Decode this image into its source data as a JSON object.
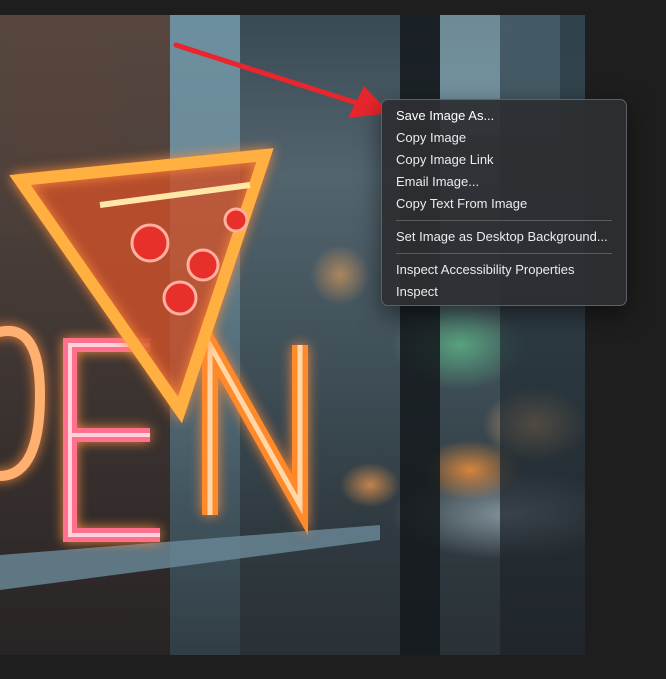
{
  "context_menu": {
    "items": [
      {
        "label": "Save Image As..."
      },
      {
        "label": "Copy Image"
      },
      {
        "label": "Copy Image Link"
      },
      {
        "label": "Email Image..."
      },
      {
        "label": "Copy Text From Image"
      },
      {
        "label": "Set Image as Desktop Background..."
      },
      {
        "label": "Inspect Accessibility Properties"
      },
      {
        "label": "Inspect"
      }
    ]
  },
  "colors": {
    "annotation_arrow": "#e8262c",
    "menu_background": "#2c2e32",
    "neon_orange": "#ff8a2a",
    "neon_pink": "#ff4d7a"
  },
  "photo": {
    "subject": "neon-open-sign-with-pizza-slice"
  }
}
